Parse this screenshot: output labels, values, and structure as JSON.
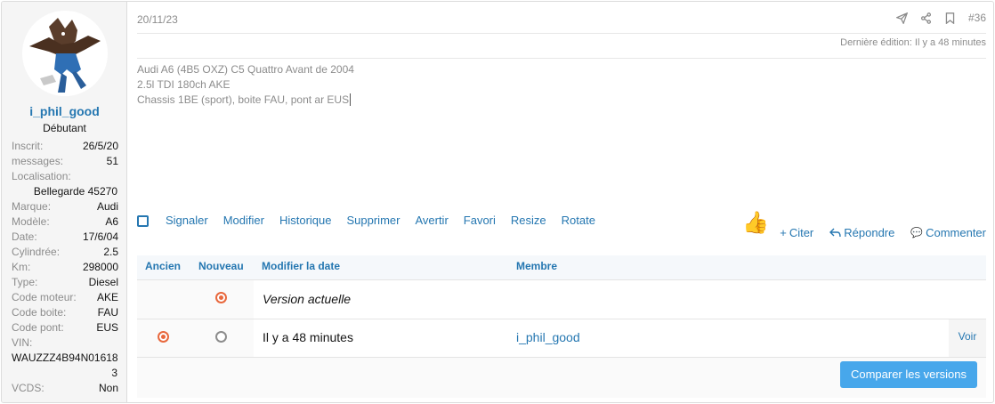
{
  "user": {
    "name": "i_phil_good",
    "title": "Débutant"
  },
  "info": [
    {
      "k": "Inscrit:",
      "v": "26/5/20"
    },
    {
      "k": "messages:",
      "v": "51"
    },
    {
      "k": "Localisation:",
      "v": ""
    },
    {
      "k": "",
      "v": "Bellegarde 45270"
    },
    {
      "k": "Marque:",
      "v": "Audi"
    },
    {
      "k": "Modèle:",
      "v": "A6"
    },
    {
      "k": "Date:",
      "v": "17/6/04"
    },
    {
      "k": "Cylindrée:",
      "v": "2.5"
    },
    {
      "k": "Km:",
      "v": "298000"
    },
    {
      "k": "Type:",
      "v": "Diesel"
    },
    {
      "k": "Code moteur:",
      "v": "AKE"
    },
    {
      "k": "Code boite:",
      "v": "FAU"
    },
    {
      "k": "Code pont:",
      "v": "EUS"
    },
    {
      "k": "VIN:",
      "v": ""
    },
    {
      "k": "",
      "v": "WAUZZZ4B94N01618"
    },
    {
      "k": "",
      "v": "3"
    },
    {
      "k": "VCDS:",
      "v": "Non"
    }
  ],
  "post": {
    "date": "20/11/23",
    "number": "#36",
    "edited": "Dernière édition: Il y a 48 minutes",
    "lines": [
      "Audi A6 (4B5 OXZ) C5 Quattro Avant de 2004",
      "2.5l TDI 180ch AKE",
      "Chassis 1BE (sport), boite FAU, pont ar EUS"
    ]
  },
  "actions": [
    "Signaler",
    "Modifier",
    "Historique",
    "Supprimer",
    "Avertir",
    "Favori",
    "Resize",
    "Rotate"
  ],
  "right_actions": {
    "quote": "Citer",
    "reply": "Répondre",
    "comment": "Commenter"
  },
  "history": {
    "headers": {
      "old": "Ancien",
      "new": "Nouveau",
      "date": "Modifier la date",
      "member": "Membre"
    },
    "current": "Version actuelle",
    "row": {
      "date": "Il y a 48 minutes",
      "member": "i_phil_good",
      "view": "Voir"
    },
    "compare": "Comparer les versions"
  },
  "colors": {
    "link": "#2577b1",
    "accent_radio": "#e8683d",
    "button": "#47a7eb"
  }
}
